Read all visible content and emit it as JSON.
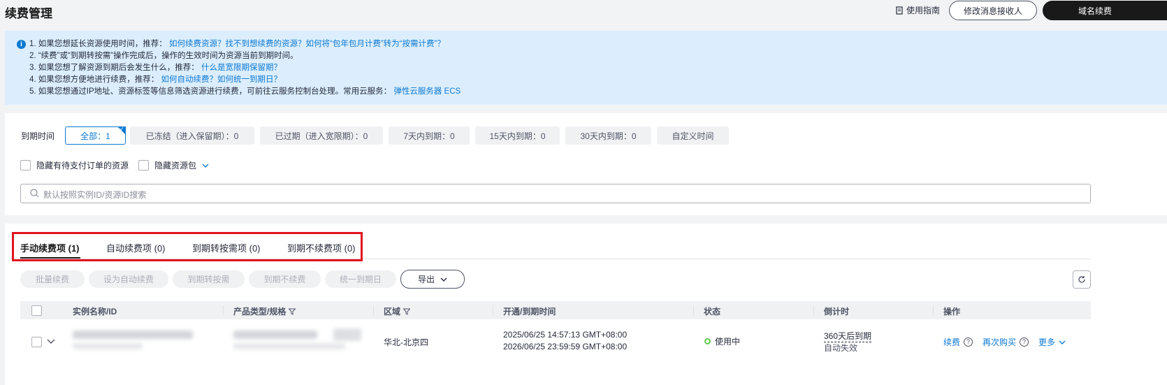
{
  "header": {
    "title": "续费管理",
    "guide_label": "使用指南",
    "modify_receiver_label": "修改消息接收人",
    "domain_renew_label": "域名续费"
  },
  "notice": {
    "line1_text": "1. 如果您想延长资源使用时间，推荐：",
    "line1_link": "如何续费资源？找不到想续费的资源？如何将“包年包月计费”转为“按需计费”？",
    "line2_text": "2. “续费”或“到期转按需”操作完成后，操作的生效时间为资源当前到期时间。",
    "line3_text": "3. 如果您想了解资源到期后会发生什么，推荐：",
    "line3_link": "什么是宽限期保留期？",
    "line4_text": "4. 如果您想方便地进行续费，推荐：",
    "line4_link": "如何自动续费？如何统一到期日？",
    "line5_text": "5. 如果您想通过IP地址、资源标签等信息筛选资源进行续费，可前往云服务控制台处理。常用云服务：",
    "line5_link": "弹性云服务器 ECS"
  },
  "filters": {
    "expire_label": "到期时间",
    "chips": [
      {
        "label": "全部：1"
      },
      {
        "label": "已冻结（进入保留期）：0"
      },
      {
        "label": "已过期（进入宽限期）：0"
      },
      {
        "label": "7天内到期：0"
      },
      {
        "label": "15天内到期：0"
      },
      {
        "label": "30天内到期：0"
      },
      {
        "label": "自定义时间"
      }
    ],
    "hide_pending_label": "隐藏有待支付订单的资源",
    "hide_package_label": "隐藏资源包",
    "search_placeholder": "默认按照实例ID/资源ID搜索"
  },
  "tabs": [
    {
      "label": "手动续费项 (1)"
    },
    {
      "label": "自动续费项 (0)"
    },
    {
      "label": "到期转按需项 (0)"
    },
    {
      "label": "到期不续费项 (0)"
    }
  ],
  "actions": {
    "batch_renew": "批量续费",
    "set_auto_renew": "设为自动续费",
    "to_on_demand": "到期转按需",
    "no_renew": "到期不续费",
    "unify_expiry": "统一到期日",
    "export": "导出"
  },
  "table": {
    "columns": [
      "实例名称/ID",
      "产品类型/规格",
      "区域",
      "开通/到期时间",
      "状态",
      "倒计时",
      "操作"
    ],
    "row": {
      "region": "华北-北京四",
      "start_time": "2025/06/25 14:57:13 GMT+08:00",
      "end_time": "2026/06/25 23:59:59 GMT+08:00",
      "status": "使用中",
      "countdown": "360天后到期",
      "countdown_note": "自动失效",
      "op_renew": "续费",
      "op_rebuy": "再次购买",
      "op_more": "更多"
    }
  },
  "colors": {
    "accent_blue": "#0d79d2",
    "highlight_red": "#e0141e",
    "status_green": "#5ec94a"
  }
}
